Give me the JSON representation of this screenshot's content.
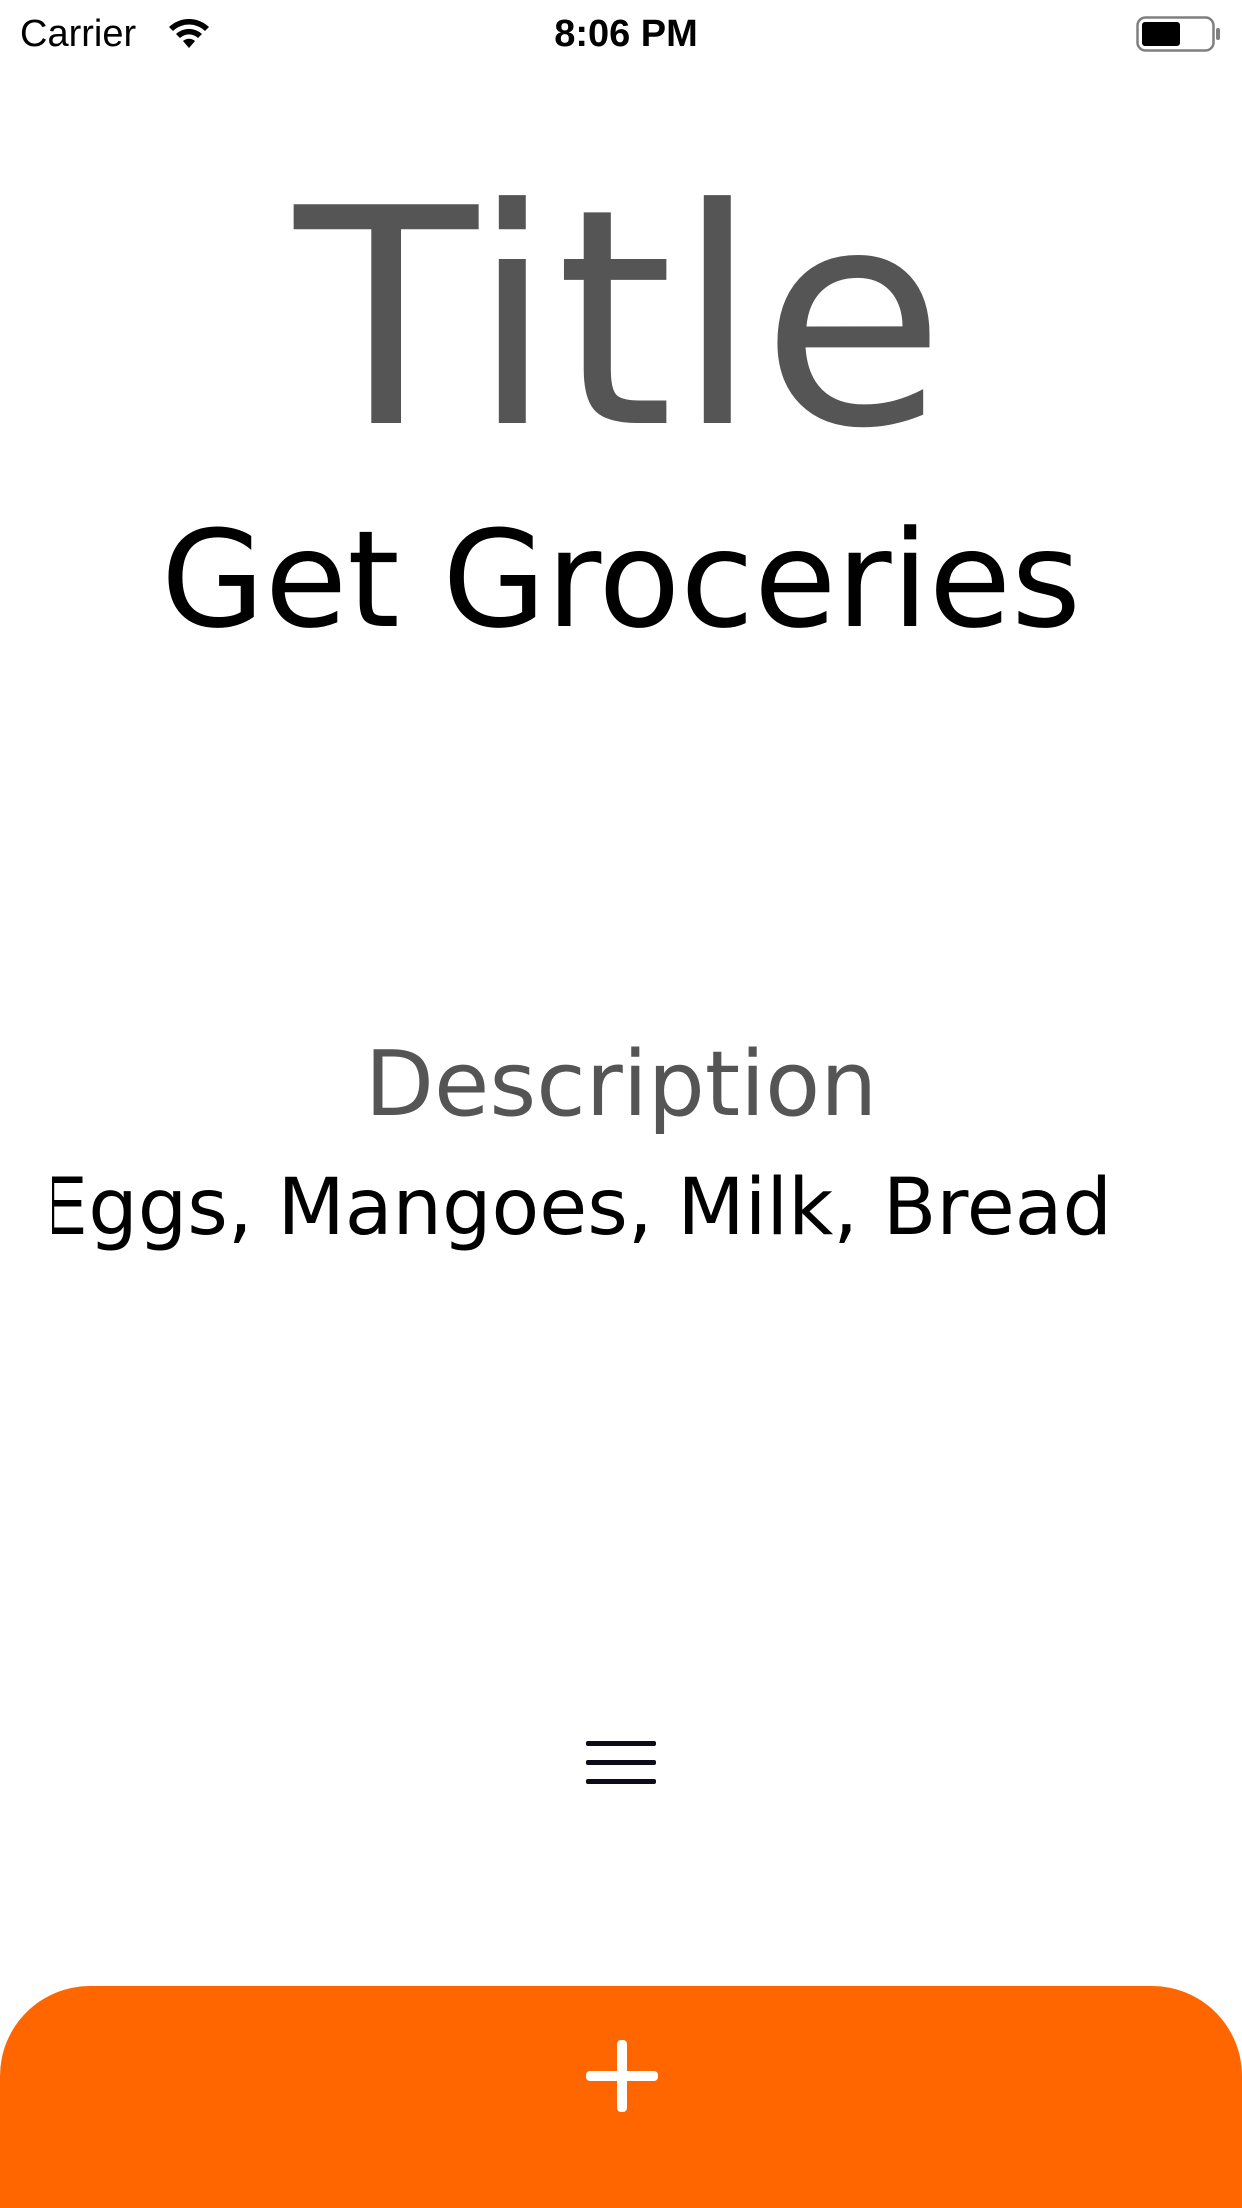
{
  "status_bar": {
    "carrier": "Carrier",
    "time": "8:06 PM",
    "wifi_icon": "wifi-icon",
    "battery_icon": "battery-icon"
  },
  "content": {
    "title_label": "Title",
    "title_value": "Get Groceries",
    "description_label": "Description",
    "description_value": "Eggs, Mangoes, Milk, Bread"
  },
  "menu": {
    "icon": "menu-icon"
  },
  "add_bar": {
    "icon": "plus-icon",
    "color": "#ff6600"
  },
  "colors": {
    "label_gray": "#555555",
    "text_black": "#000000",
    "accent": "#ff6600"
  }
}
